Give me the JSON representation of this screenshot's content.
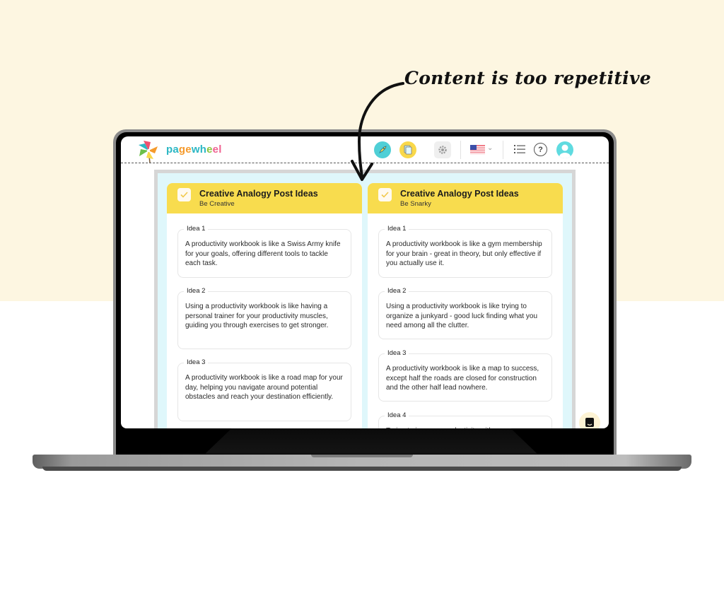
{
  "annotation": {
    "text": "Content is too repetitive"
  },
  "app": {
    "brand": {
      "letters": [
        "p",
        "a",
        "g",
        "e",
        "w",
        "h",
        "e",
        "e",
        "l"
      ],
      "letter_colors": [
        "#2bb7c4",
        "#2bb7c4",
        "#f59a2c",
        "#f59a2c",
        "#2bb7c4",
        "#2bb7c4",
        "#8cc63f",
        "#f06292",
        "#f06292"
      ]
    },
    "header": {
      "icons": [
        "rocket-icon",
        "document-icon",
        "gear-icon",
        "us-flag-icon",
        "chevron-down-icon",
        "list-icon",
        "help-icon",
        "user-avatar-icon"
      ],
      "help_symbol": "?",
      "chevron_symbol": "⌄"
    },
    "colors": {
      "header_yellow": "#f8dc4e",
      "teal": "#4fcfd6",
      "panel_bg": "#dff7fb",
      "page_bg": "#fdf6e1"
    }
  },
  "columns": [
    {
      "title": "Creative Analogy Post Ideas",
      "subtitle": "Be Creative",
      "checked": true,
      "ideas": [
        {
          "label": "Idea 1",
          "text": "A productivity workbook is like a Swiss Army knife for your goals, offering different tools to tackle each task."
        },
        {
          "label": "Idea 2",
          "text": "Using a productivity workbook is like having a personal trainer for your productivity muscles, guiding you through exercises to get stronger."
        },
        {
          "label": "Idea 3",
          "text": "A productivity workbook is like a road map for your day, helping you navigate around potential obstacles and reach your destination efficiently."
        }
      ]
    },
    {
      "title": "Creative Analogy Post Ideas",
      "subtitle": "Be Snarky",
      "checked": true,
      "ideas": [
        {
          "label": "Idea 1",
          "text": "A productivity workbook is like a gym membership for your brain - great in theory, but only effective if you actually use it."
        },
        {
          "label": "Idea 2",
          "text": "Using a productivity workbook is like trying to organize a junkyard - good luck finding what you need among all the clutter."
        },
        {
          "label": "Idea 3",
          "text": "A productivity workbook is like a map to success, except half the roads are closed for construction and the other half lead nowhere."
        },
        {
          "label": "Idea 4",
          "text": "Trying to improve productivity with a"
        }
      ]
    }
  ]
}
